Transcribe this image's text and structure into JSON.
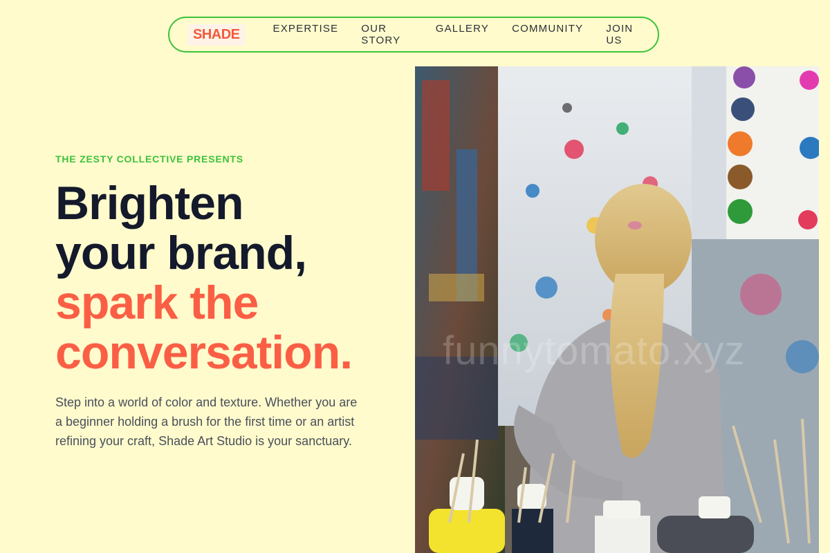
{
  "nav": {
    "logo": "SHADE",
    "links": [
      "EXPERTISE",
      "OUR STORY",
      "GALLERY",
      "COMMUNITY",
      "JOIN US"
    ]
  },
  "hero": {
    "eyebrow": "THE ZESTY COLLECTIVE PRESENTS",
    "headline": {
      "line1": "Brighten",
      "line2": "your brand,",
      "accent_line1": "spark the",
      "accent_line2": "conversation."
    },
    "description": "Step into a world of color and texture. Whether you are a beginner holding a brush for the first time or an artist refining your craft, Shade Art Studio is your sanctuary.",
    "image_watermark": "funnytomato.xyz"
  },
  "colors": {
    "background": "#fffbcc",
    "accent_green": "#3cc23a",
    "accent_coral": "#fa5f45",
    "headline_dark": "#141a2b"
  }
}
